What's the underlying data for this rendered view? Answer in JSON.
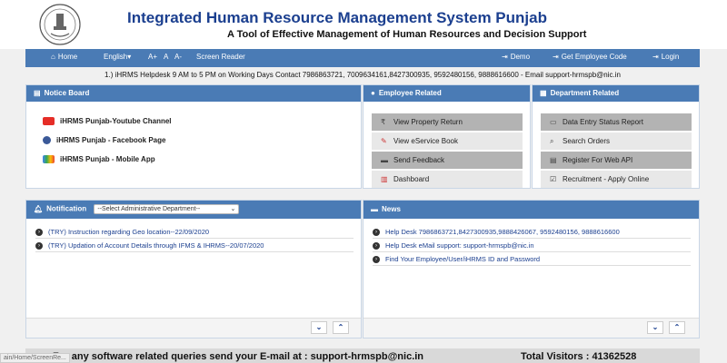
{
  "header": {
    "title": "Integrated Human Resource Management System Punjab",
    "subtitle": "A Tool of Effective Management of Human Resources and Decision Support"
  },
  "nav": {
    "home": "Home",
    "language": "English",
    "font_increase": "A+",
    "font_normal": "A",
    "font_decrease": "A-",
    "screen_reader": "Screen Reader",
    "demo": "Demo",
    "get_employee_code": "Get Employee Code",
    "login": "Login"
  },
  "helpline": "1.) iHRMS Helpdesk 9 AM to 5 PM on Working Days Contact 7986863721, 7009634161,8427300935, 9592480156, 9888616600 - Email support-hrmspb@nic.in",
  "notice_board": {
    "title": "Notice Board",
    "items": [
      {
        "label": "iHRMS Punjab-Youtube Channel"
      },
      {
        "label": "iHRMS Punjab - Facebook Page"
      },
      {
        "label": "iHRMS Punjab - Mobile App"
      }
    ]
  },
  "employee_related": {
    "title": "Employee Related",
    "buttons": [
      {
        "label": "View Property Return"
      },
      {
        "label": "View eService Book"
      },
      {
        "label": "Send Feedback"
      },
      {
        "label": "Dashboard"
      }
    ]
  },
  "department_related": {
    "title": "Department Related",
    "buttons": [
      {
        "label": "Data Entry Status Report"
      },
      {
        "label": "Search Orders"
      },
      {
        "label": "Register For Web API"
      },
      {
        "label": "Recruitment - Apply Online"
      }
    ]
  },
  "notification": {
    "title": "Notification",
    "select_value": "--Select Administrative Department--",
    "items": [
      {
        "text": "(TRY) Instruction regarding Geo location--22/09/2020"
      },
      {
        "text": "(TRY) Updation of Account Details through IFMS & IHRMS--20/07/2020"
      }
    ]
  },
  "news": {
    "title": "News",
    "items": [
      {
        "text": "Help Desk 7986863721,8427300935,9888426067, 9592480156, 9888616600"
      },
      {
        "text": "Help Desk eMail support: support-hrmspb@nic.in"
      },
      {
        "text": "Find Your Employee/User/iHRMS ID and Password"
      }
    ]
  },
  "footer": {
    "query_text": "For any software related queries send your E-mail at : support-hrmspb@nic.in",
    "visitors_text": "Total Visitors : 41362528"
  },
  "status_url": "ain/Home/ScreenRe...",
  "colors": {
    "accent": "#4a7bb5",
    "title_blue": "#1b3f8f",
    "youtube": "#e52d27",
    "facebook": "#3b5998"
  }
}
